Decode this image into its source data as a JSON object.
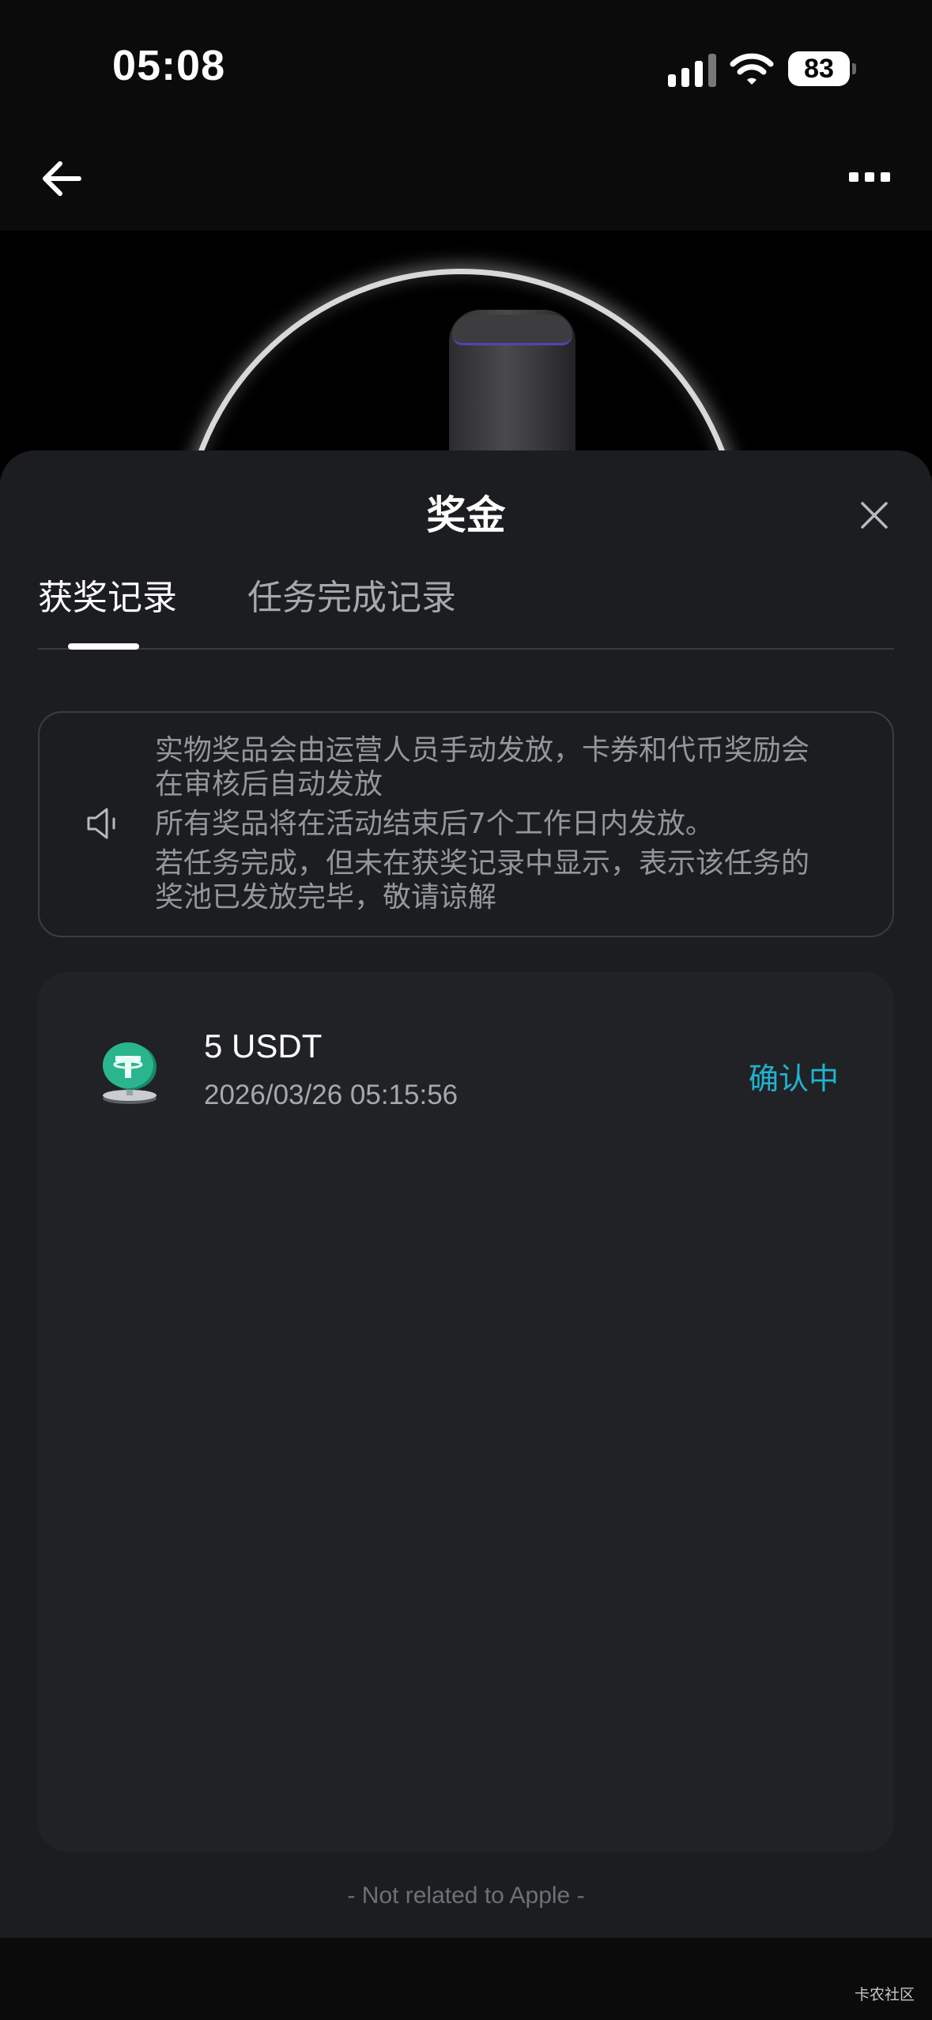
{
  "status_bar": {
    "time": "05:08",
    "battery": "83"
  },
  "nav": {
    "back_icon": "arrow-left-icon",
    "more_icon": "more-dots-icon"
  },
  "sheet": {
    "title": "奖金",
    "close_icon": "close-icon",
    "tabs": [
      {
        "label": "获奖记录",
        "active": true
      },
      {
        "label": "任务完成记录",
        "active": false
      }
    ],
    "notice": {
      "icon": "speaker-icon",
      "lines": [
        "实物奖品会由运营人员手动发放，卡券和代币奖励会",
        "在审核后自动发放",
        "所有奖品将在活动结束后7个工作日内发放。",
        "若任务完成，但未在获奖记录中显示，表示该任务的",
        "奖池已发放完毕，敬请谅解"
      ]
    },
    "records": [
      {
        "icon": "usdt-coin-icon",
        "amount": "5 USDT",
        "time": "2026/03/26 05:15:56",
        "status": "确认中"
      }
    ],
    "footer_note": "- Not related to Apple -"
  },
  "watermark": "卡农社区",
  "colors": {
    "accent_status": "#1fb3d0",
    "sheet_bg": "#1c1d20",
    "card_bg": "#212226",
    "coin": "#2bb58f"
  }
}
